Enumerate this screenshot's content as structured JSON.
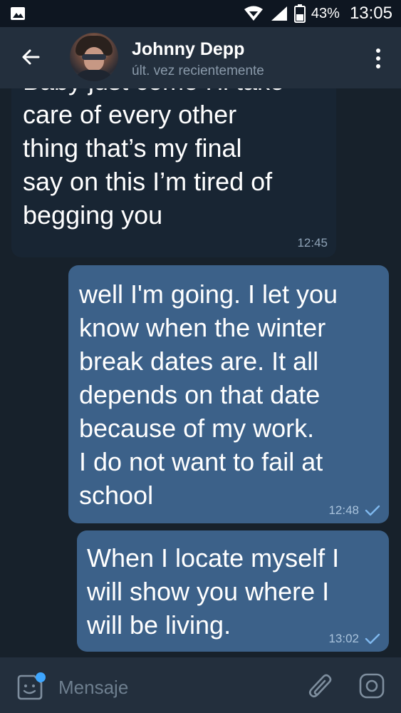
{
  "status_bar": {
    "battery_percent": "43%",
    "time": "13:05"
  },
  "header": {
    "contact_name": "Johnny Depp",
    "contact_status": "últ. vez recientemente"
  },
  "messages": [
    {
      "direction": "incoming",
      "text": "Baby just come I'll take\ncare of every other\nthing that’s my final\nsay on this I’m tired of\nbegging you",
      "time": "12:45"
    },
    {
      "direction": "outgoing",
      "text": "well I'm going. I let you\nknow when the winter\nbreak dates are. It all\ndepends on that date\nbecause of my work.\nI do not want to fail at\nschool",
      "time": "12:48",
      "read_icon": "check-icon"
    },
    {
      "direction": "outgoing",
      "text": "When I locate myself I\nwill show you where I\nwill be living.",
      "time": "13:02",
      "read_icon": "check-icon"
    }
  ],
  "input_bar": {
    "placeholder": "Mensaje",
    "icons": [
      "sticker-icon",
      "paperclip-icon",
      "camera-icon"
    ]
  },
  "colors": {
    "background": "#17212b",
    "header": "#232f3d",
    "incoming_bubble": "#182533",
    "outgoing_bubble": "#3c6189",
    "accent_dot": "#3ea6ff"
  }
}
